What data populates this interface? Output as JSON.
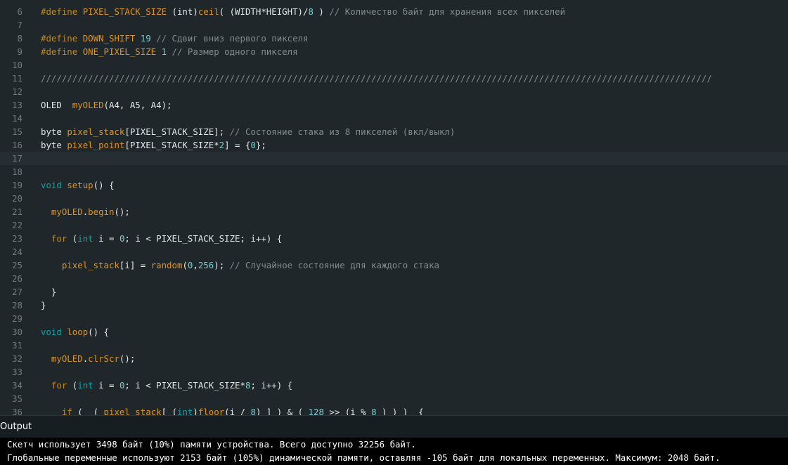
{
  "editor": {
    "current_line": "17",
    "lines": [
      {
        "num": "6",
        "tokens": [
          [
            "kw",
            "#define "
          ],
          [
            "fn",
            "PIXEL_STACK_SIZE"
          ],
          [
            "pl",
            " (int)"
          ],
          [
            "fn",
            "ceil"
          ],
          [
            "pl",
            "( (WIDTH*HEIGHT)/"
          ],
          [
            "num",
            "8"
          ],
          [
            "pl",
            " ) "
          ],
          [
            "cm",
            "// Количество байт для хранения всех пикселей"
          ]
        ]
      },
      {
        "num": "7",
        "tokens": []
      },
      {
        "num": "8",
        "tokens": [
          [
            "kw",
            "#define "
          ],
          [
            "fn",
            "DOWN_SHIFT"
          ],
          [
            "pl",
            " "
          ],
          [
            "num",
            "19"
          ],
          [
            "pl",
            " "
          ],
          [
            "cm",
            "// Сдвиг вниз первого пикселя"
          ]
        ]
      },
      {
        "num": "9",
        "tokens": [
          [
            "kw",
            "#define "
          ],
          [
            "fn",
            "ONE_PIXEL_SIZE"
          ],
          [
            "pl",
            " "
          ],
          [
            "num",
            "1"
          ],
          [
            "pl",
            " "
          ],
          [
            "cm",
            "// Размер одного пикселя"
          ]
        ]
      },
      {
        "num": "10",
        "tokens": []
      },
      {
        "num": "11",
        "tokens": [
          [
            "cm",
            "////////////////////////////////////////////////////////////////////////////////////////////////////////////////////////////////"
          ]
        ]
      },
      {
        "num": "12",
        "tokens": []
      },
      {
        "num": "13",
        "tokens": [
          [
            "pl",
            "OLED  "
          ],
          [
            "fn",
            "myOLED"
          ],
          [
            "pl",
            "(A4, A5, A4);"
          ]
        ]
      },
      {
        "num": "14",
        "tokens": []
      },
      {
        "num": "15",
        "tokens": [
          [
            "pl",
            "byte "
          ],
          [
            "fn",
            "pixel_stack"
          ],
          [
            "pl",
            "[PIXEL_STACK_SIZE]; "
          ],
          [
            "cm",
            "// Состояние стака из 8 пикселей (вкл/выкл)"
          ]
        ]
      },
      {
        "num": "16",
        "tokens": [
          [
            "pl",
            "byte "
          ],
          [
            "fn",
            "pixel_point"
          ],
          [
            "pl",
            "[PIXEL_STACK_SIZE*"
          ],
          [
            "num",
            "2"
          ],
          [
            "pl",
            "] = {"
          ],
          [
            "num",
            "0"
          ],
          [
            "pl",
            "};"
          ]
        ]
      },
      {
        "num": "17",
        "tokens": []
      },
      {
        "num": "18",
        "tokens": []
      },
      {
        "num": "19",
        "tokens": [
          [
            "ty",
            "void "
          ],
          [
            "fn",
            "setup"
          ],
          [
            "pl",
            "() {"
          ]
        ]
      },
      {
        "num": "20",
        "tokens": []
      },
      {
        "num": "21",
        "tokens": [
          [
            "pl",
            "  "
          ],
          [
            "fn",
            "myOLED"
          ],
          [
            "pl",
            "."
          ],
          [
            "fn",
            "begin"
          ],
          [
            "pl",
            "();"
          ]
        ]
      },
      {
        "num": "22",
        "tokens": []
      },
      {
        "num": "23",
        "tokens": [
          [
            "pl",
            "  "
          ],
          [
            "kw",
            "for"
          ],
          [
            "pl",
            " ("
          ],
          [
            "ty",
            "int"
          ],
          [
            "pl",
            " i = "
          ],
          [
            "num",
            "0"
          ],
          [
            "pl",
            "; i < PIXEL_STACK_SIZE; i++) {"
          ]
        ]
      },
      {
        "num": "24",
        "tokens": []
      },
      {
        "num": "25",
        "tokens": [
          [
            "pl",
            "    "
          ],
          [
            "fn",
            "pixel_stack"
          ],
          [
            "pl",
            "[i] = "
          ],
          [
            "fn",
            "random"
          ],
          [
            "pl",
            "("
          ],
          [
            "num",
            "0"
          ],
          [
            "pl",
            ","
          ],
          [
            "num",
            "256"
          ],
          [
            "pl",
            "); "
          ],
          [
            "cm",
            "// Случайное состояние для каждого стака"
          ]
        ]
      },
      {
        "num": "26",
        "tokens": []
      },
      {
        "num": "27",
        "tokens": [
          [
            "pl",
            "  }"
          ]
        ]
      },
      {
        "num": "28",
        "tokens": [
          [
            "pl",
            "}"
          ]
        ]
      },
      {
        "num": "29",
        "tokens": []
      },
      {
        "num": "30",
        "tokens": [
          [
            "ty",
            "void "
          ],
          [
            "fn",
            "loop"
          ],
          [
            "pl",
            "() {"
          ]
        ]
      },
      {
        "num": "31",
        "tokens": []
      },
      {
        "num": "32",
        "tokens": [
          [
            "pl",
            "  "
          ],
          [
            "fn",
            "myOLED"
          ],
          [
            "pl",
            "."
          ],
          [
            "fn",
            "clrScr"
          ],
          [
            "pl",
            "();"
          ]
        ]
      },
      {
        "num": "33",
        "tokens": []
      },
      {
        "num": "34",
        "tokens": [
          [
            "pl",
            "  "
          ],
          [
            "kw",
            "for"
          ],
          [
            "pl",
            " ("
          ],
          [
            "ty",
            "int"
          ],
          [
            "pl",
            " i = "
          ],
          [
            "num",
            "0"
          ],
          [
            "pl",
            "; i < PIXEL_STACK_SIZE*"
          ],
          [
            "num",
            "8"
          ],
          [
            "pl",
            "; i++) {"
          ]
        ]
      },
      {
        "num": "35",
        "tokens": []
      },
      {
        "num": "36",
        "tokens": [
          [
            "pl",
            "    "
          ],
          [
            "kw",
            "if"
          ],
          [
            "pl",
            " (  ( "
          ],
          [
            "fn",
            "pixel_stack"
          ],
          [
            "pl",
            "[ ("
          ],
          [
            "ty",
            "int"
          ],
          [
            "pl",
            ")"
          ],
          [
            "fn",
            "floor"
          ],
          [
            "pl",
            "(i / "
          ],
          [
            "num",
            "8"
          ],
          [
            "pl",
            ") ] ) & ( "
          ],
          [
            "num",
            "128"
          ],
          [
            "pl",
            " >> (i % "
          ],
          [
            "num",
            "8"
          ],
          [
            "pl",
            " ) ) )  {"
          ]
        ]
      }
    ]
  },
  "output": {
    "title": "Output",
    "lines": [
      "Скетч использует 3498 байт (10%) памяти устройства. Всего доступно 32256 байт.",
      "Глобальные переменные используют 2153 байт (105%) динамической памяти, оставляя -105 байт для локальных переменных. Максимум: 2048 байт."
    ]
  }
}
